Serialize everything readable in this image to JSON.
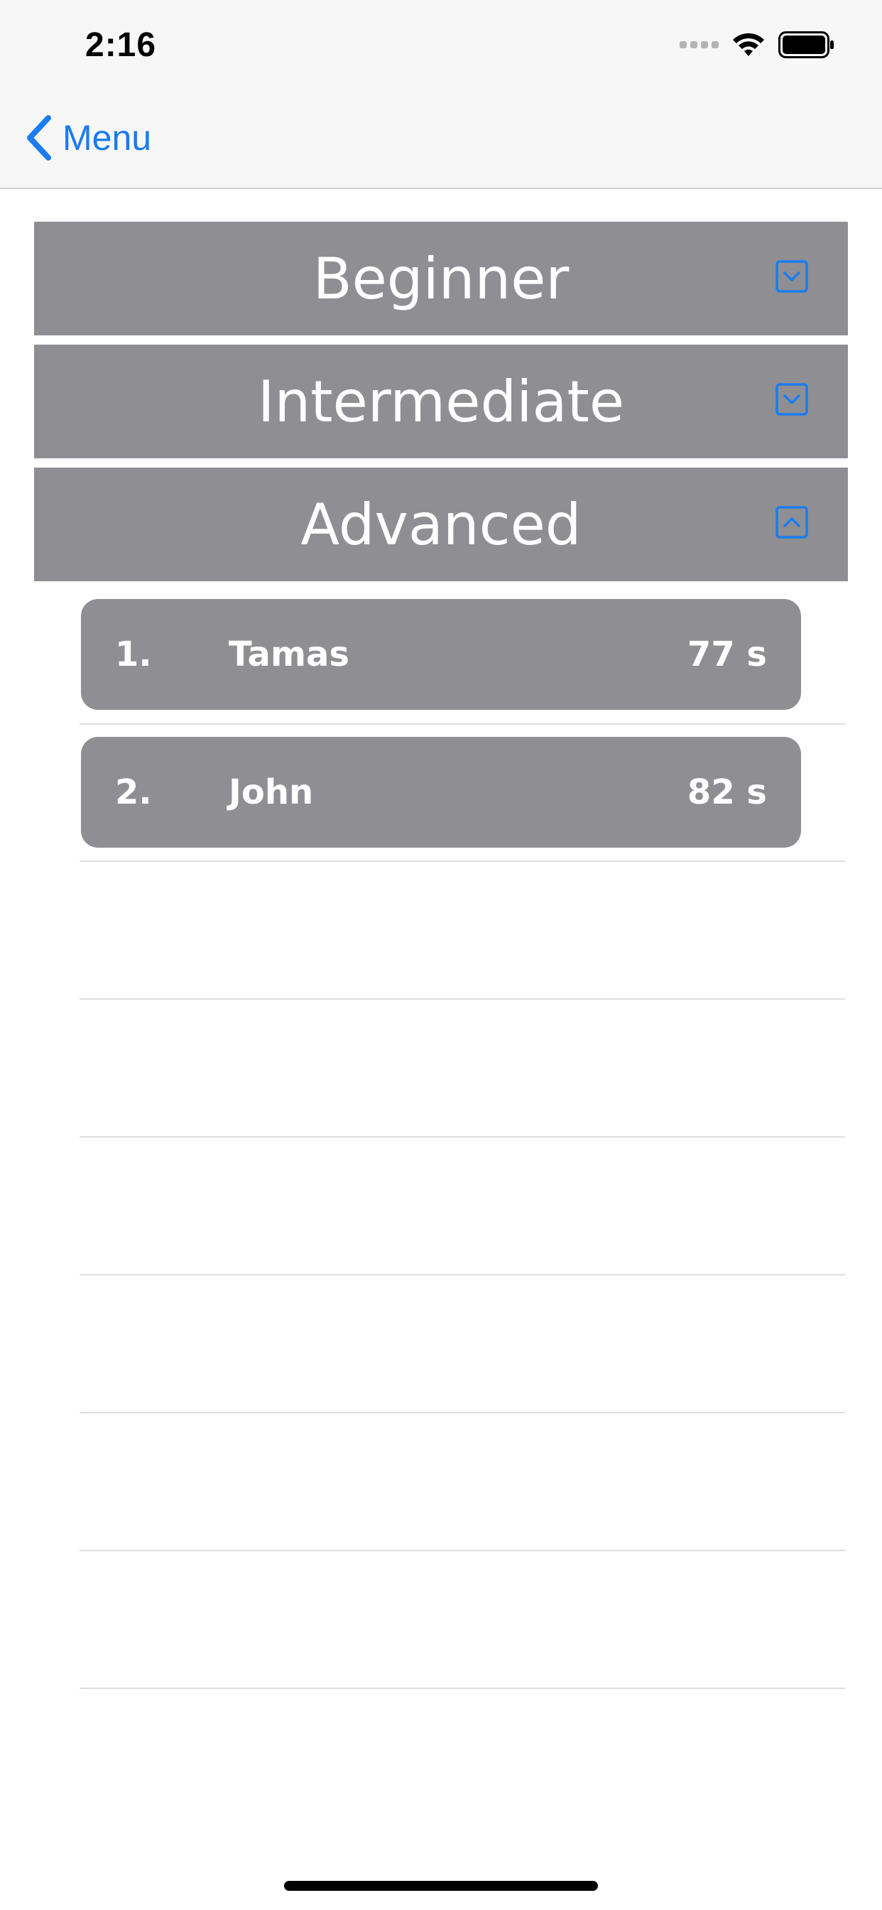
{
  "status_bar": {
    "time": "2:16"
  },
  "nav": {
    "back_label": "Menu",
    "accent_color": "#1a7cf0"
  },
  "sections": [
    {
      "title": "Beginner",
      "state": "collapsed"
    },
    {
      "title": "Intermediate",
      "state": "collapsed"
    },
    {
      "title": "Advanced",
      "state": "expanded"
    }
  ],
  "scores": [
    {
      "rank": "1.",
      "name": "Tamas",
      "time": "77 s"
    },
    {
      "rank": "2.",
      "name": "John",
      "time": "82 s"
    }
  ],
  "icons": {
    "back": "chevron-left-icon",
    "collapsed": "chevron-down-square-icon",
    "expanded": "chevron-up-square-icon"
  }
}
